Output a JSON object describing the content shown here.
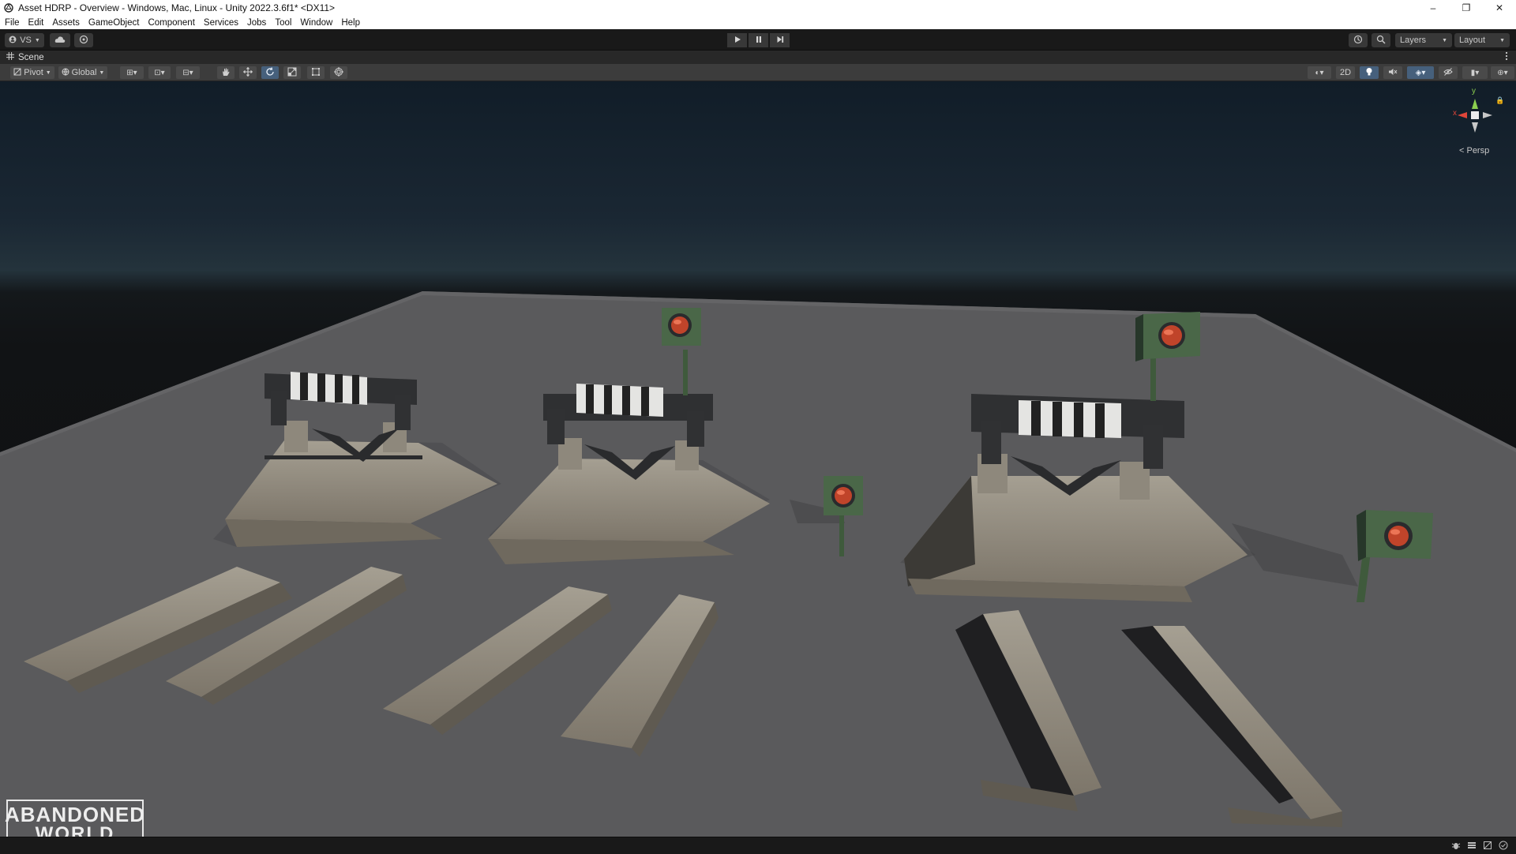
{
  "window": {
    "title": "Asset HDRP - Overview - Windows, Mac, Linux - Unity 2022.3.6f1* <DX11>",
    "minimize_glyph": "–",
    "maximize_glyph": "❐",
    "close_glyph": "✕"
  },
  "menu": [
    "File",
    "Edit",
    "Assets",
    "GameObject",
    "Component",
    "Services",
    "Jobs",
    "Tool",
    "Window",
    "Help"
  ],
  "toolbar": {
    "account_label": "VS",
    "layers_label": "Layers",
    "layout_label": "Layout"
  },
  "scene_tab": {
    "label": "Scene"
  },
  "scene_toolbar": {
    "pivot_label": "Pivot",
    "global_label": "Global",
    "mode_2d_label": "2D"
  },
  "gizmo": {
    "y_label": "y",
    "x_label": "x",
    "projection_label": "< Persp"
  },
  "watermark": {
    "line1": "ABANDONED",
    "line2": "WORLD"
  },
  "colors": {
    "accent": "#46607c",
    "editor_dark": "#191919",
    "toolbar": "#3c3c3c"
  },
  "icons": {
    "play": "play-icon",
    "pause": "pause-icon",
    "step": "step-icon",
    "hand": "hand-tool-icon",
    "move": "move-tool-icon",
    "rotate": "rotate-tool-icon",
    "scale": "scale-tool-icon",
    "rect": "rect-tool-icon",
    "transform": "transform-tool-icon"
  }
}
